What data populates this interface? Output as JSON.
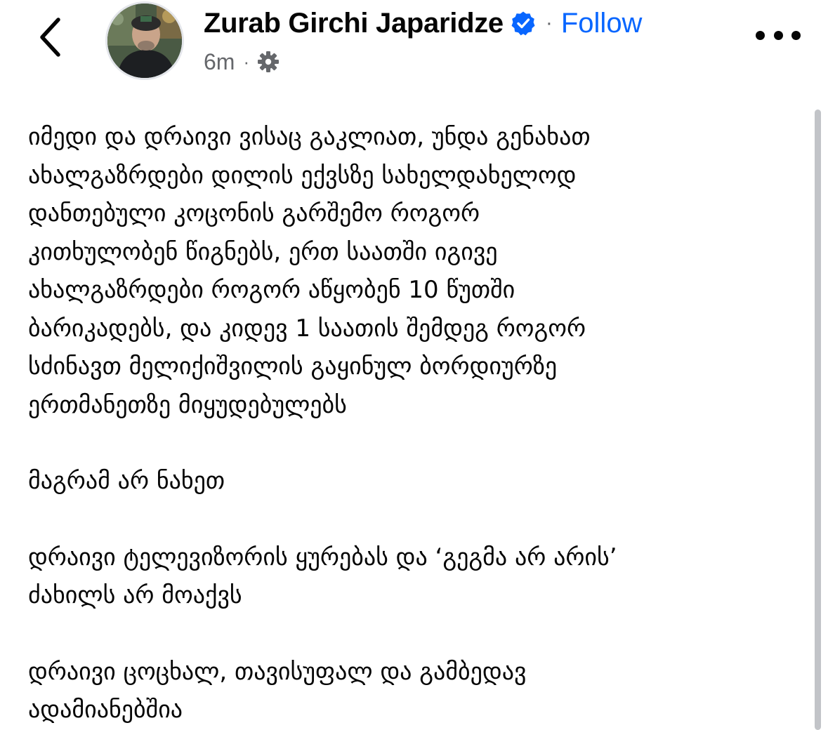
{
  "header": {
    "back_icon": "chevron-left-icon",
    "author_name": "Zurab Girchi Japaridze",
    "verified_icon": "verified-badge-icon",
    "separator": "·",
    "follow_label": "Follow",
    "timestamp": "6m",
    "meta_separator": "·",
    "privacy_icon": "gear-icon",
    "more_icon": "more-horizontal-icon"
  },
  "colors": {
    "accent": "#0866ff",
    "text": "#050505",
    "secondary": "#65676b",
    "scrollbar": "#c2c4c8"
  },
  "post": {
    "paragraphs": [
      {
        "lines": [
          "იმედი და დრაივი ვისაც გაკლიათ, უნდა გენახათ",
          "ახალგაზრდები დილის ექვსზე სახელდახელოდ",
          "დანთებული კოცონის გარშემო როგორ",
          "კითხულობენ წიგნებს, ერთ საათში იგივე",
          "ახალგაზრდები როგორ აწყობენ 10 წუთში",
          "ბარიკადებს, და კიდევ 1 საათის შემდეგ როგორ",
          "სძინავთ მელიქიშვილის გაყინულ ბორდიურზე",
          "ერთმანეთზე მიყუდებულებს"
        ]
      },
      {
        "lines": [
          "მაგრამ არ ნახეთ"
        ]
      },
      {
        "lines": [
          "დრაივი ტელევიზორის ყურებას და ‘გეგმა არ არის’",
          "ძახილს არ მოაქვს"
        ]
      },
      {
        "lines": [
          "დრაივი ცოცხალ, თავისუფალ და გამბედავ",
          "ადამიანებშია"
        ]
      }
    ]
  }
}
